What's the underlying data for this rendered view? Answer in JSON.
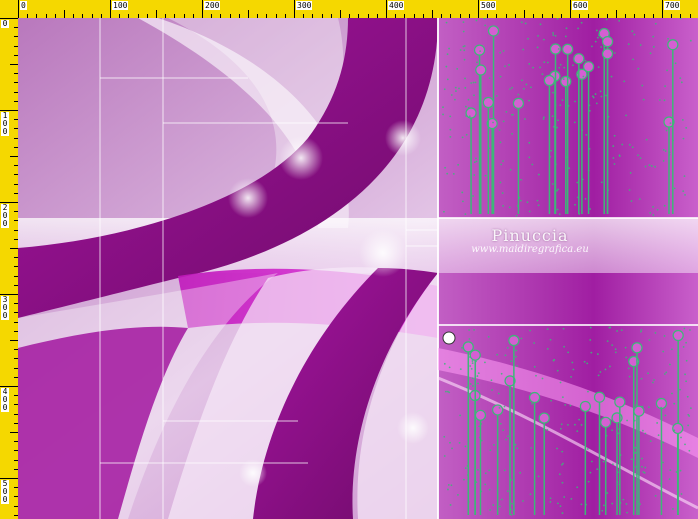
{
  "ruler": {
    "top_labels": [
      "0",
      "100",
      "200",
      "300",
      "400",
      "500",
      "600",
      "700"
    ],
    "left_labels": [
      "0",
      "100",
      "200",
      "300",
      "400",
      "500"
    ]
  },
  "watermark": {
    "name": "Pinuccia",
    "site": "www.maidiregrafica.eu"
  },
  "colors": {
    "ruler_bg": "#f5d800",
    "magenta_dark": "#8a0a7a",
    "magenta_bright": "#d21ad2",
    "lilac": "#c98ccf",
    "circuit_green": "#3cb878"
  }
}
